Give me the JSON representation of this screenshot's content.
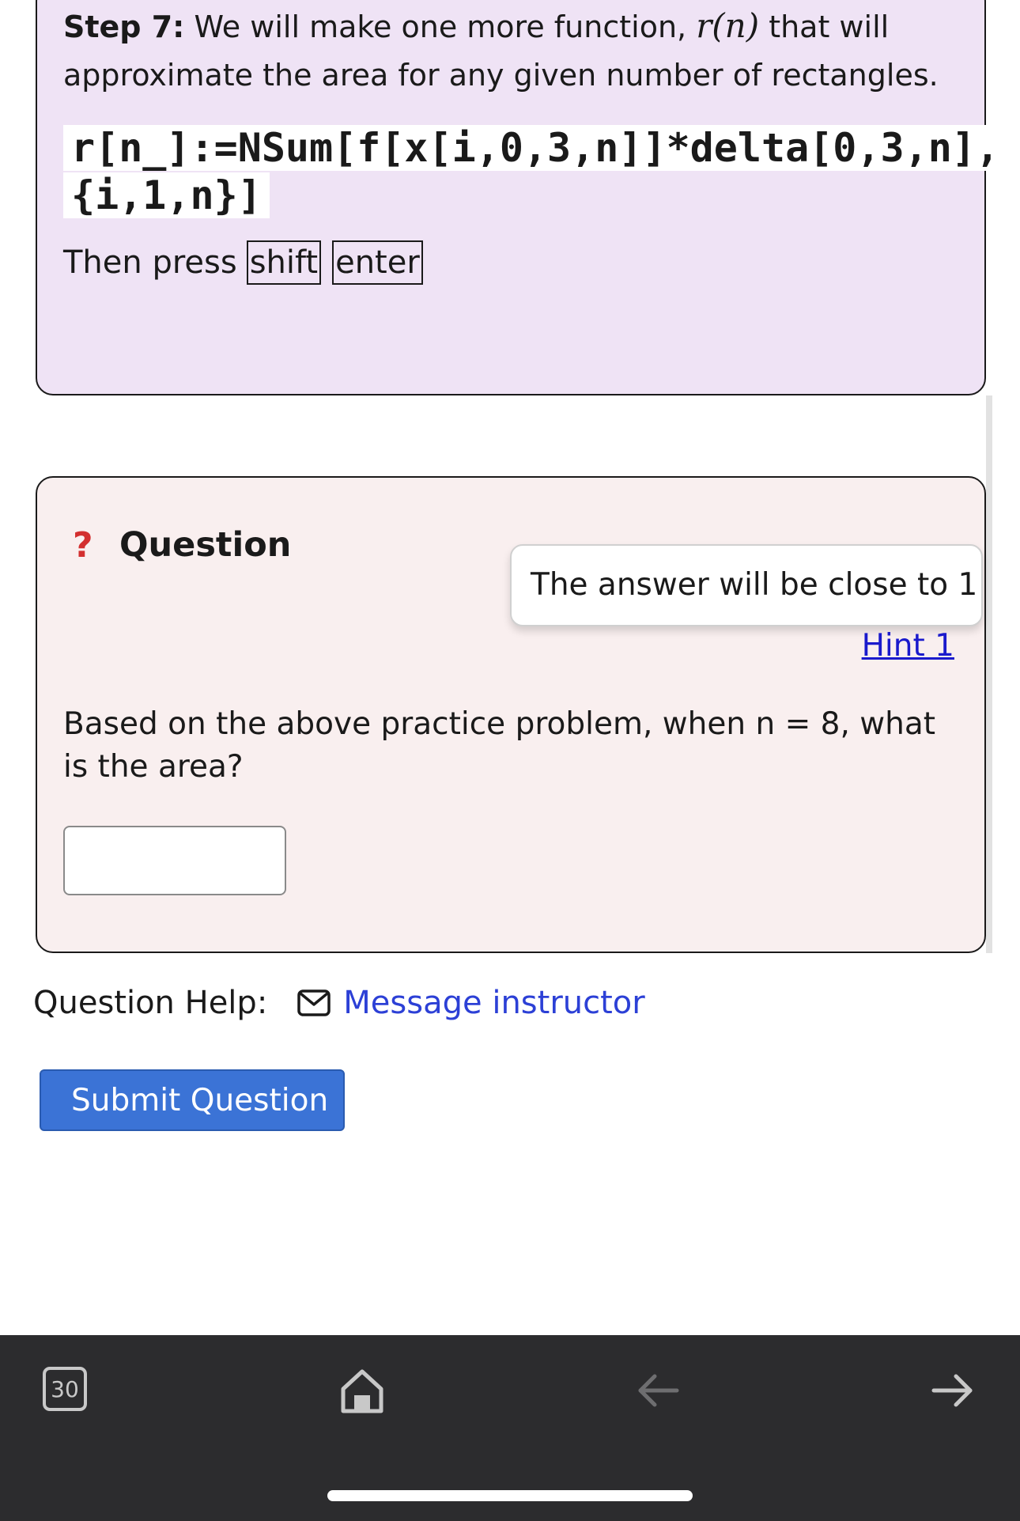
{
  "step": {
    "label": "Step 7:",
    "text_before": " We will make one more function, ",
    "math": "r(n)",
    "text_after": "  that will approximate the area for any given number of rectangles.",
    "code": "r[n_]:=NSum[f[x[i,0,3,n]]*delta[0,3,n],{i,1,n}]",
    "press_prefix": "Then press",
    "key1": "shift",
    "key2": "enter"
  },
  "question": {
    "icon": "?",
    "title": "Question",
    "hint_popup": "The answer will be close to 1",
    "hint_link": "Hint 1",
    "prompt": "Based on the above practice problem, when n = 8, what is the area?",
    "answer_value": ""
  },
  "help": {
    "label": "Question Help:",
    "message_link": "Message instructor"
  },
  "submit_label": "Submit Question",
  "browser": {
    "tab_count": "30"
  },
  "icons": {
    "mail": "mail-icon",
    "home": "home-icon",
    "back": "arrow-left-icon",
    "forward": "arrow-right-icon"
  },
  "colors": {
    "step_bg": "#efe3f5",
    "question_bg": "#f9efef",
    "link": "#2c40d6",
    "submit": "#3b73d6",
    "question_icon": "#d32f2f"
  }
}
